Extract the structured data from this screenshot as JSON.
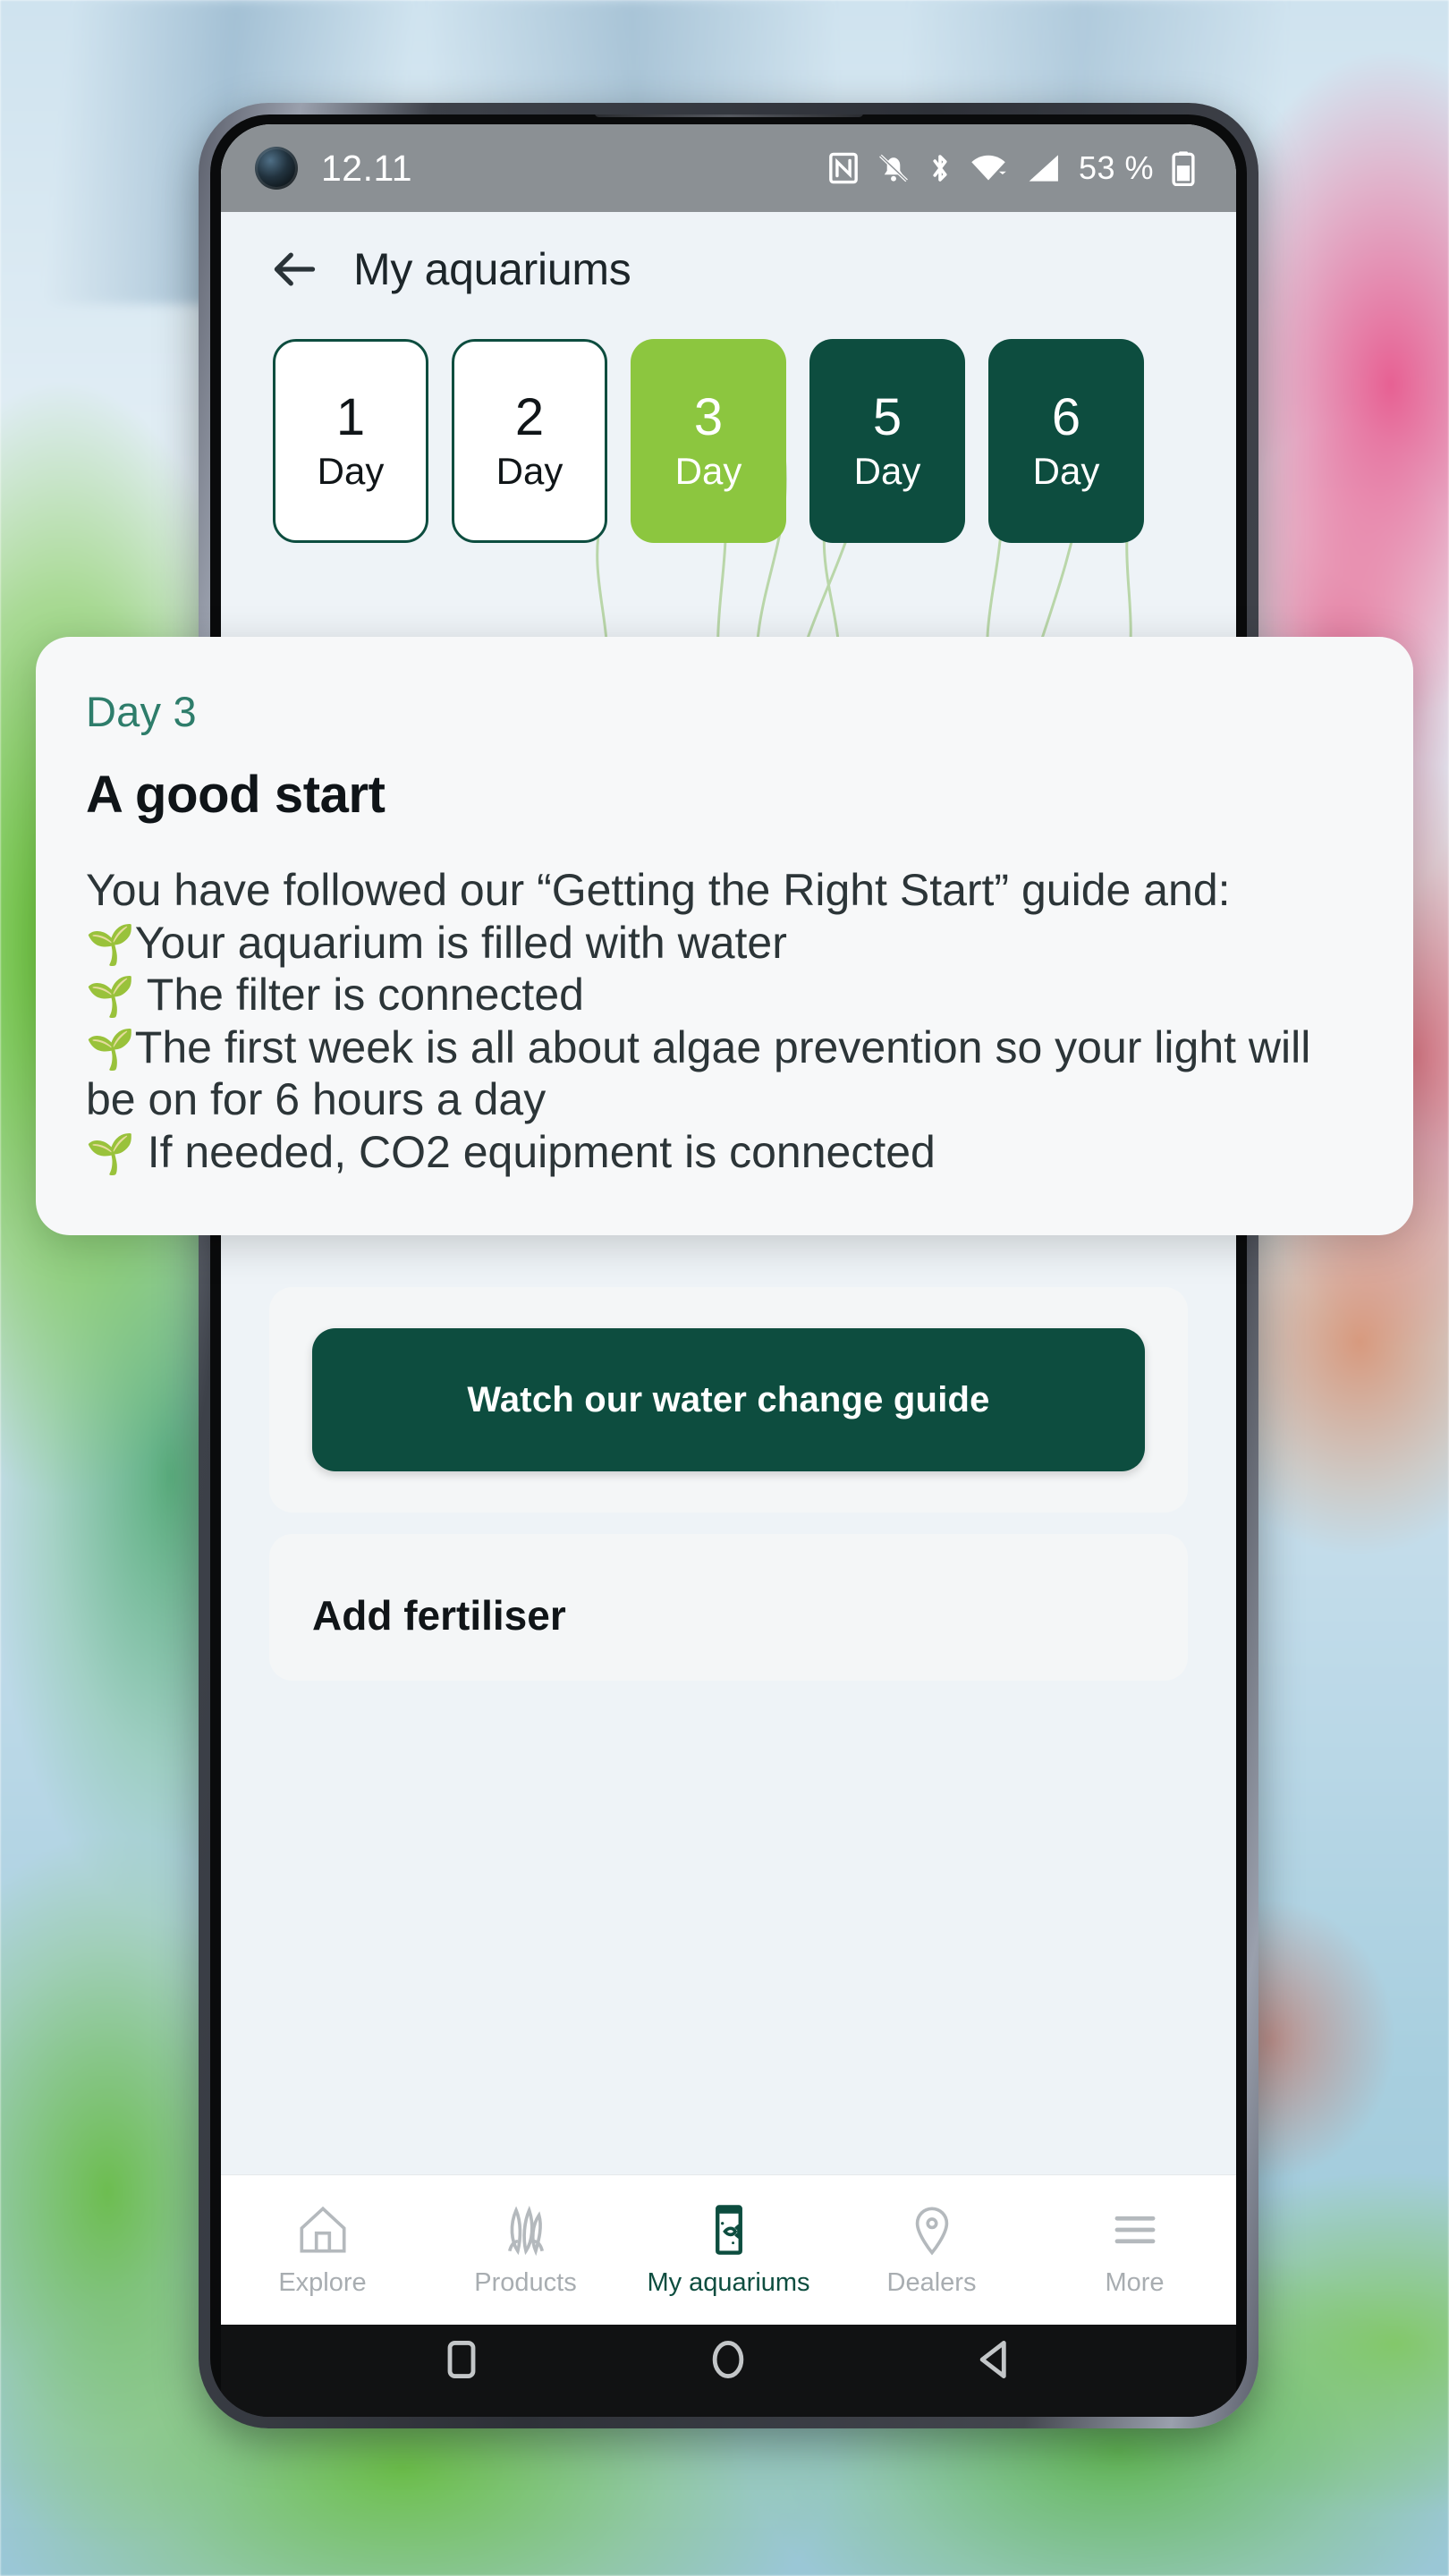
{
  "statusbar": {
    "time": "12.11",
    "battery_percent": "53 %",
    "icons": [
      "nfc-icon",
      "bell-muted-icon",
      "bluetooth-icon",
      "wifi-icon",
      "signal-icon",
      "battery-icon"
    ]
  },
  "header": {
    "back_icon": "back-arrow-icon",
    "title": "My aquariums"
  },
  "days": [
    {
      "num": "1",
      "label": "Day",
      "state": "outline"
    },
    {
      "num": "2",
      "label": "Day",
      "state": "outline"
    },
    {
      "num": "3",
      "label": "Day",
      "state": "current"
    },
    {
      "num": "5",
      "label": "Day",
      "state": "dark"
    },
    {
      "num": "6",
      "label": "Day",
      "state": "dark"
    }
  ],
  "overlay": {
    "day_prefix": "Day",
    "day_number": "3",
    "day_label": "Day 3",
    "title": "A good start",
    "intro": "You have followed our “Getting the Right Start” guide and:",
    "bullets": [
      "Your aquarium is filled with water",
      "The filter is connected",
      "The first week is all about algae prevention so your light will be on for 6 hours a day",
      "If needed, CO2 equipment is connected"
    ],
    "bullet_icon": "🌱"
  },
  "main": {
    "cta_label": "Watch our water change guide",
    "next_block_title": "Add fertiliser"
  },
  "bottom_nav": [
    {
      "label": "Explore",
      "icon": "home-icon",
      "active": false
    },
    {
      "label": "Products",
      "icon": "plants-icon",
      "active": false
    },
    {
      "label": "My aquariums",
      "icon": "fishtank-icon",
      "active": true
    },
    {
      "label": "Dealers",
      "icon": "map-pin-icon",
      "active": false
    },
    {
      "label": "More",
      "icon": "hamburger-icon",
      "active": false
    }
  ],
  "android_nav": [
    {
      "name": "recents-button",
      "icon": "square-icon"
    },
    {
      "name": "home-button",
      "icon": "circle-icon"
    },
    {
      "name": "back-button",
      "icon": "triangle-left-icon"
    }
  ],
  "colors": {
    "brand_dark_green": "#0d4d3f",
    "accent_light_green": "#8cc63f",
    "teal_text": "#2e7d6b",
    "screen_bg": "#eef3f7",
    "overlay_bg": "#f7f8f9"
  }
}
